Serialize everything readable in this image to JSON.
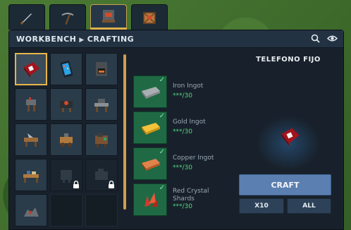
{
  "tabs": [
    {
      "icon": "sword-icon"
    },
    {
      "icon": "pickaxe-icon"
    },
    {
      "icon": "workbench-icon",
      "active": true
    },
    {
      "icon": "crate-icon"
    }
  ],
  "header": {
    "crumb_root": "WORKBENCH",
    "crumb_current": "CRAFTING",
    "search_icon": "search-icon",
    "visibility_icon": "eye-icon"
  },
  "recipes": [
    {
      "icon": "red-phone-icon",
      "selected": true
    },
    {
      "icon": "smartphone-icon"
    },
    {
      "icon": "furnace-icon"
    },
    {
      "icon": "anvil-station-icon"
    },
    {
      "icon": "forge-icon"
    },
    {
      "icon": "workstation-icon"
    },
    {
      "icon": "sawmill-icon"
    },
    {
      "icon": "cart-icon"
    },
    {
      "icon": "machine-icon"
    },
    {
      "icon": "desk-icon"
    },
    {
      "icon": "locked-machine-icon",
      "locked": true
    },
    {
      "icon": "locked-machine-icon",
      "locked": true
    },
    {
      "icon": "scrap-pile-icon"
    }
  ],
  "selected_item": {
    "title": "TELEFONO FIJO",
    "preview_icon": "red-phone-icon"
  },
  "ingredients": [
    {
      "name": "Iron Ingot",
      "qty": "***/30",
      "icon": "iron-ingot-icon",
      "color": "#a9aeb3"
    },
    {
      "name": "Gold Ingot",
      "qty": "***/30",
      "icon": "gold-ingot-icon",
      "color": "#e3a71d"
    },
    {
      "name": "Copper Ingot",
      "qty": "***/30",
      "icon": "copper-ingot-icon",
      "color": "#c9642e"
    },
    {
      "name": "Red Crystal Shards",
      "qty": "***/30",
      "icon": "red-crystal-icon",
      "color": "#d43a2a"
    }
  ],
  "buttons": {
    "craft": "CRAFT",
    "x10": "X10",
    "all": "ALL"
  },
  "colors": {
    "accent_gold": "#e0b24f",
    "craft_button": "#5b7fb0",
    "ingredient_bg": "#1f6a44",
    "qty_green": "#54d87f"
  }
}
